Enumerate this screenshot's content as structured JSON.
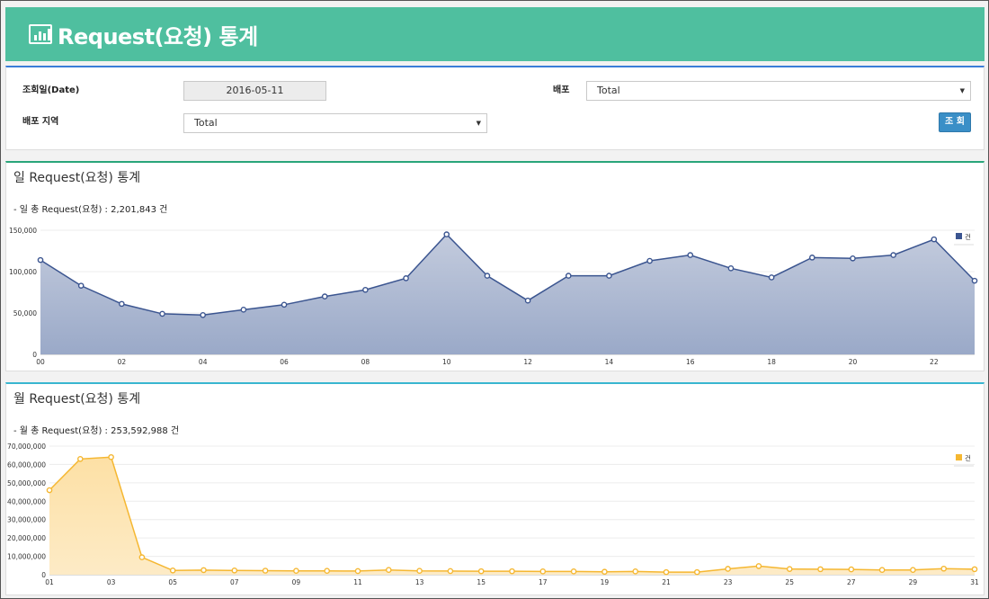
{
  "header": {
    "title": "Request(요청) 통계",
    "icon": "bar-chart-icon"
  },
  "filters": {
    "date_label": "조회일(Date)",
    "date_value": "2016-05-11",
    "deploy_label": "배포",
    "deploy_value": "Total",
    "region_label": "배포 지역",
    "region_value": "Total",
    "search_button": "조 회"
  },
  "daily": {
    "title": "일 Request(요청) 통계",
    "total_text": "- 일 총 Request(요청) : 2,201,843 건"
  },
  "monthly": {
    "title": "월 Request(요청) 통계",
    "total_text": "- 월 총 Request(요청) : 253,592,988 건"
  },
  "chart_data": [
    {
      "type": "area",
      "x": [
        "00",
        "01",
        "02",
        "03",
        "04",
        "05",
        "06",
        "07",
        "08",
        "09",
        "10",
        "11",
        "12",
        "13",
        "14",
        "15",
        "16",
        "17",
        "18",
        "19",
        "20",
        "21",
        "22",
        "23"
      ],
      "tick_labels": [
        "00",
        "02",
        "04",
        "06",
        "08",
        "10",
        "12",
        "14",
        "16",
        "18",
        "20",
        "22"
      ],
      "series": [
        {
          "name": "건",
          "values": [
            114000,
            83000,
            61000,
            49000,
            47500,
            54000,
            60000,
            70000,
            78000,
            92000,
            145000,
            95000,
            65000,
            95000,
            95000,
            113000,
            120000,
            104000,
            93000,
            117000,
            116000,
            120000,
            139000,
            89000
          ],
          "color": "#3b5590"
        }
      ],
      "ylim": [
        0,
        150000
      ],
      "yticks": [
        "0",
        "50,000",
        "100,000",
        "150,000"
      ],
      "legend": "top-right",
      "grid": true
    },
    {
      "type": "area",
      "x": [
        "01",
        "02",
        "03",
        "04",
        "05",
        "06",
        "07",
        "08",
        "09",
        "10",
        "11",
        "12",
        "13",
        "14",
        "15",
        "16",
        "17",
        "18",
        "19",
        "20",
        "21",
        "22",
        "23",
        "24",
        "25",
        "26",
        "27",
        "28",
        "29",
        "30",
        "31"
      ],
      "tick_labels": [
        "01",
        "03",
        "05",
        "07",
        "09",
        "11",
        "13",
        "15",
        "17",
        "19",
        "21",
        "23",
        "25",
        "27",
        "29",
        "31"
      ],
      "series": [
        {
          "name": "건",
          "values": [
            46000000,
            63000000,
            64000000,
            9500000,
            2300000,
            2500000,
            2300000,
            2200000,
            2100000,
            2100000,
            2000000,
            2600000,
            2100000,
            2000000,
            1900000,
            1900000,
            1800000,
            1800000,
            1600000,
            1800000,
            1400000,
            1400000,
            3200000,
            4700000,
            3100000,
            3000000,
            2900000,
            2600000,
            2600000,
            3300000,
            3000000
          ],
          "color": "#f5b731"
        }
      ],
      "ylim": [
        0,
        70000000
      ],
      "yticks": [
        "0",
        "10,000,000",
        "20,000,000",
        "30,000,000",
        "40,000,000",
        "50,000,000",
        "60,000,000",
        "70,000,000"
      ],
      "legend": "top-right",
      "grid": true
    }
  ]
}
